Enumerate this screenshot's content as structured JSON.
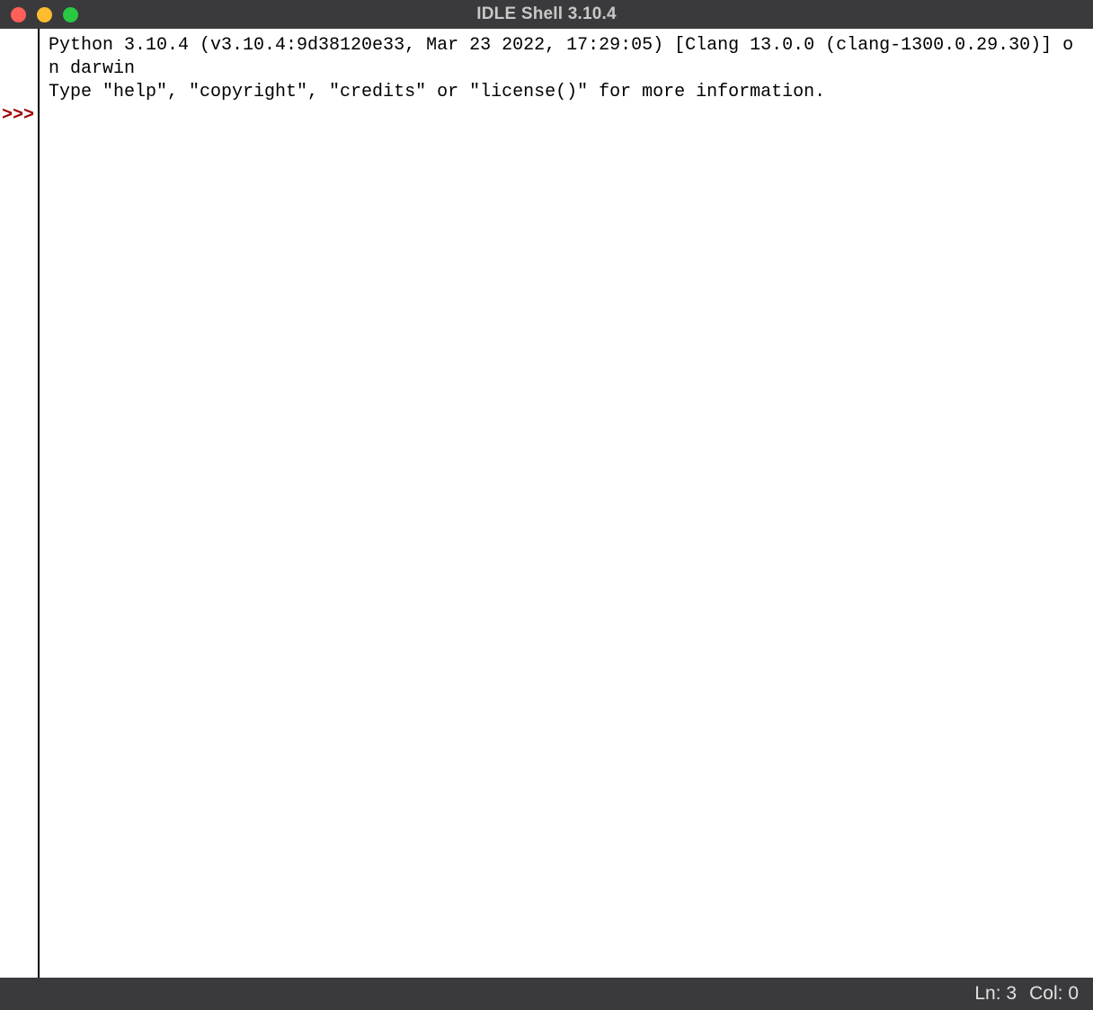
{
  "window": {
    "title": "IDLE Shell 3.10.4"
  },
  "shell": {
    "banner_line1": "Python 3.10.4 (v3.10.4:9d38120e33, Mar 23 2022, 17:29:05) [Clang 13.0.0 (clang-1300.0.29.30)] on darwin",
    "banner_line2": "Type \"help\", \"copyright\", \"credits\" or \"license()\" for more information.",
    "prompt": ">>>"
  },
  "status": {
    "line_label": "Ln:",
    "line_value": "3",
    "col_label": "Col:",
    "col_value": "0"
  }
}
